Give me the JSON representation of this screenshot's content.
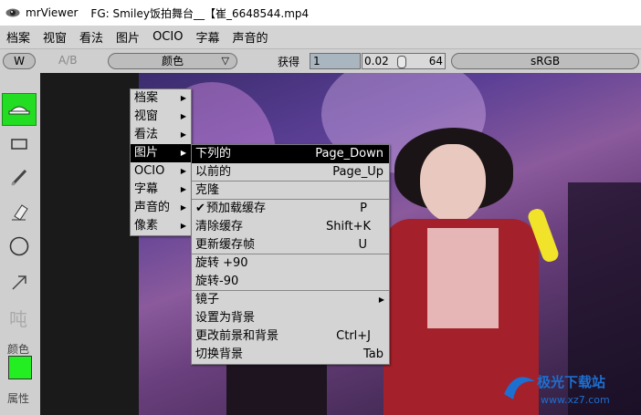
{
  "window": {
    "app_name": "mrViewer",
    "file_title": "FG: Smiley饭拍舞台__【崔_6648544.mp4"
  },
  "menubar": [
    "档案",
    "视窗",
    "看法",
    "图片",
    "OCIO",
    "字幕",
    "声音的"
  ],
  "toolbar": {
    "w_label": "W",
    "ab_label": "A/B",
    "color_label": "颜色",
    "gain_label": "获得",
    "gain_value": "1",
    "slider_min": "0.02",
    "slider_max": "64",
    "colorspace": "sRGB"
  },
  "sidebar": {
    "tools": [
      "scrub-icon",
      "rectangle-icon",
      "pencil-icon",
      "eraser-icon",
      "circle-icon",
      "arrow-icon"
    ],
    "text_tool": "吨",
    "color_label": "颜色",
    "color_value": "#22ee22",
    "props_label": "属性"
  },
  "context_menu": {
    "items": [
      "档案",
      "视窗",
      "看法",
      "图片",
      "OCIO",
      "字幕",
      "声音的",
      "像素"
    ],
    "selected_index": 3
  },
  "image_submenu": {
    "items": [
      {
        "label": "下列的",
        "shortcut": "Page_Down"
      },
      {
        "label": "以前的",
        "shortcut": "Page_Up"
      },
      {
        "label": "克隆",
        "shortcut": ""
      },
      {
        "label": "预加载缓存",
        "shortcut": "P"
      },
      {
        "label": "清除缓存",
        "shortcut": "Shift+K"
      },
      {
        "label": "更新缓存帧",
        "shortcut": "U"
      },
      {
        "label": "旋转 +90",
        "shortcut": ""
      },
      {
        "label": "旋转-90",
        "shortcut": ""
      },
      {
        "label": "镜子",
        "shortcut": ""
      },
      {
        "label": "设置为背景",
        "shortcut": ""
      },
      {
        "label": "更改前景和背景",
        "shortcut": "Ctrl+J"
      },
      {
        "label": "切换背景",
        "shortcut": "Tab"
      }
    ]
  },
  "watermark": {
    "brand": "极光下载站",
    "url": "www.xz7.com"
  }
}
